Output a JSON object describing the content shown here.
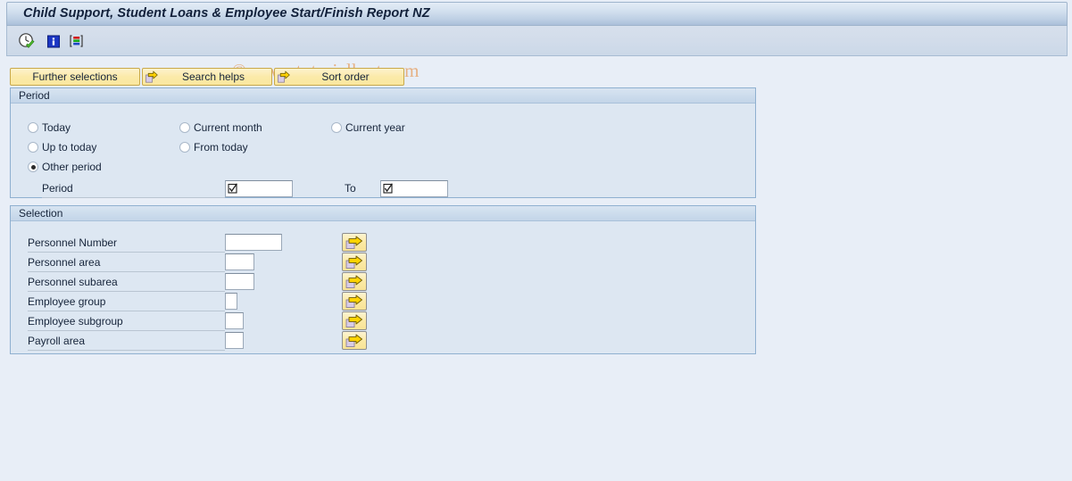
{
  "window": {
    "title": "Child Support, Student Loans & Employee Start/Finish Report NZ"
  },
  "watermark": "© www.tutorialkart.com",
  "toolbar": {
    "icons": [
      {
        "name": "execute-clock-icon",
        "title": "Execute"
      },
      {
        "name": "info-icon",
        "title": "Information"
      },
      {
        "name": "variant-icon",
        "title": "Get Variant"
      }
    ]
  },
  "selection_buttons": [
    {
      "label": "Further selections",
      "icon": null
    },
    {
      "label": "Search helps",
      "icon": "arrow-right-icon"
    },
    {
      "label": "Sort order",
      "icon": "arrow-right-icon"
    }
  ],
  "period_panel": {
    "title": "Period",
    "options": [
      {
        "label": "Today",
        "selected": false
      },
      {
        "label": "Current month",
        "selected": false
      },
      {
        "label": "Current year",
        "selected": false
      },
      {
        "label": "Up to today",
        "selected": false
      },
      {
        "label": "From today",
        "selected": false
      },
      {
        "label": "Other period",
        "selected": true
      }
    ],
    "period_label": "Period",
    "period_value": "",
    "to_label": "To",
    "to_value": ""
  },
  "selection_panel": {
    "title": "Selection",
    "rows": [
      {
        "label": "Personnel Number",
        "value": "",
        "field_width": 64
      },
      {
        "label": "Personnel area",
        "value": "",
        "field_width": 33
      },
      {
        "label": "Personnel subarea",
        "value": "",
        "field_width": 33
      },
      {
        "label": "Employee group",
        "value": "",
        "field_width": 14
      },
      {
        "label": "Employee subgroup",
        "value": "",
        "field_width": 21
      },
      {
        "label": "Payroll area",
        "value": "",
        "field_width": 21
      }
    ],
    "multi_select_icon": "arrow-right-icon"
  },
  "colors": {
    "background": "#e8eef7",
    "panel_fill": "#dde7f2",
    "panel_border": "#8fb0d0",
    "button_yellow": "#fae79f",
    "watermark": "#e6b184",
    "text": "#16243a"
  }
}
